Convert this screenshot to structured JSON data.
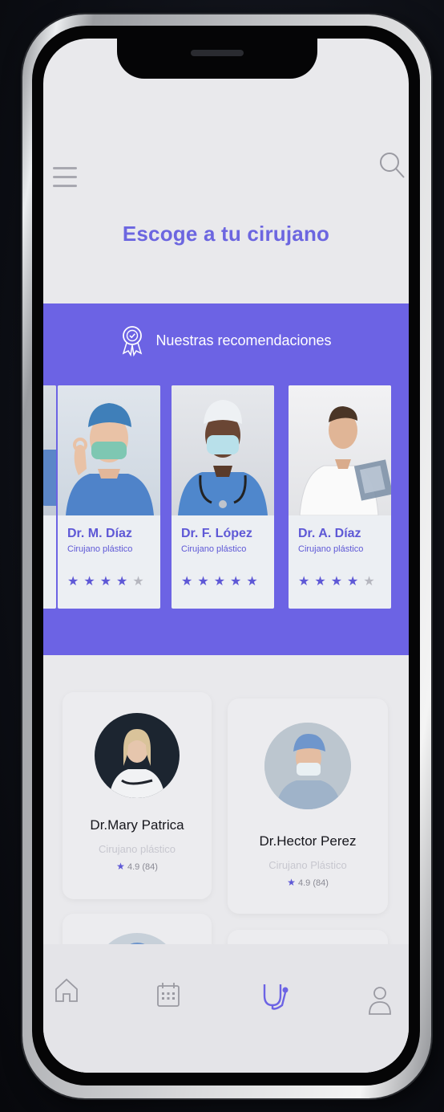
{
  "header": {
    "title": "Escoge a tu cirujano",
    "menu_icon": "hamburger-menu-icon",
    "search_icon": "search-icon"
  },
  "recommendations": {
    "heading": "Nuestras recomendaciones",
    "icon": "award-badge-icon",
    "accent": "#6c63e4",
    "cards": [
      {
        "name": "Dr. M. Díaz",
        "specialty": "Cirujano plástico",
        "rating_stars": 4
      },
      {
        "name": "Dr. F. López",
        "specialty": "Cirujano plástico",
        "rating_stars": 5
      },
      {
        "name": "Dr. A. Díaz",
        "specialty": "Cirujano plástico",
        "rating_stars": 4
      }
    ]
  },
  "doctors": [
    {
      "name": "Dr.Mary Patrica",
      "specialty": "Cirujano plástico",
      "rating": "4.9",
      "reviews": "(84)"
    },
    {
      "name": "Dr.Hector Perez",
      "specialty": "Cirujano Plástico",
      "rating": "4.9",
      "reviews": "(84)"
    }
  ],
  "nav": {
    "items": [
      "home-icon",
      "calendar-icon",
      "stethoscope-icon",
      "profile-icon"
    ],
    "active": "stethoscope-icon"
  }
}
